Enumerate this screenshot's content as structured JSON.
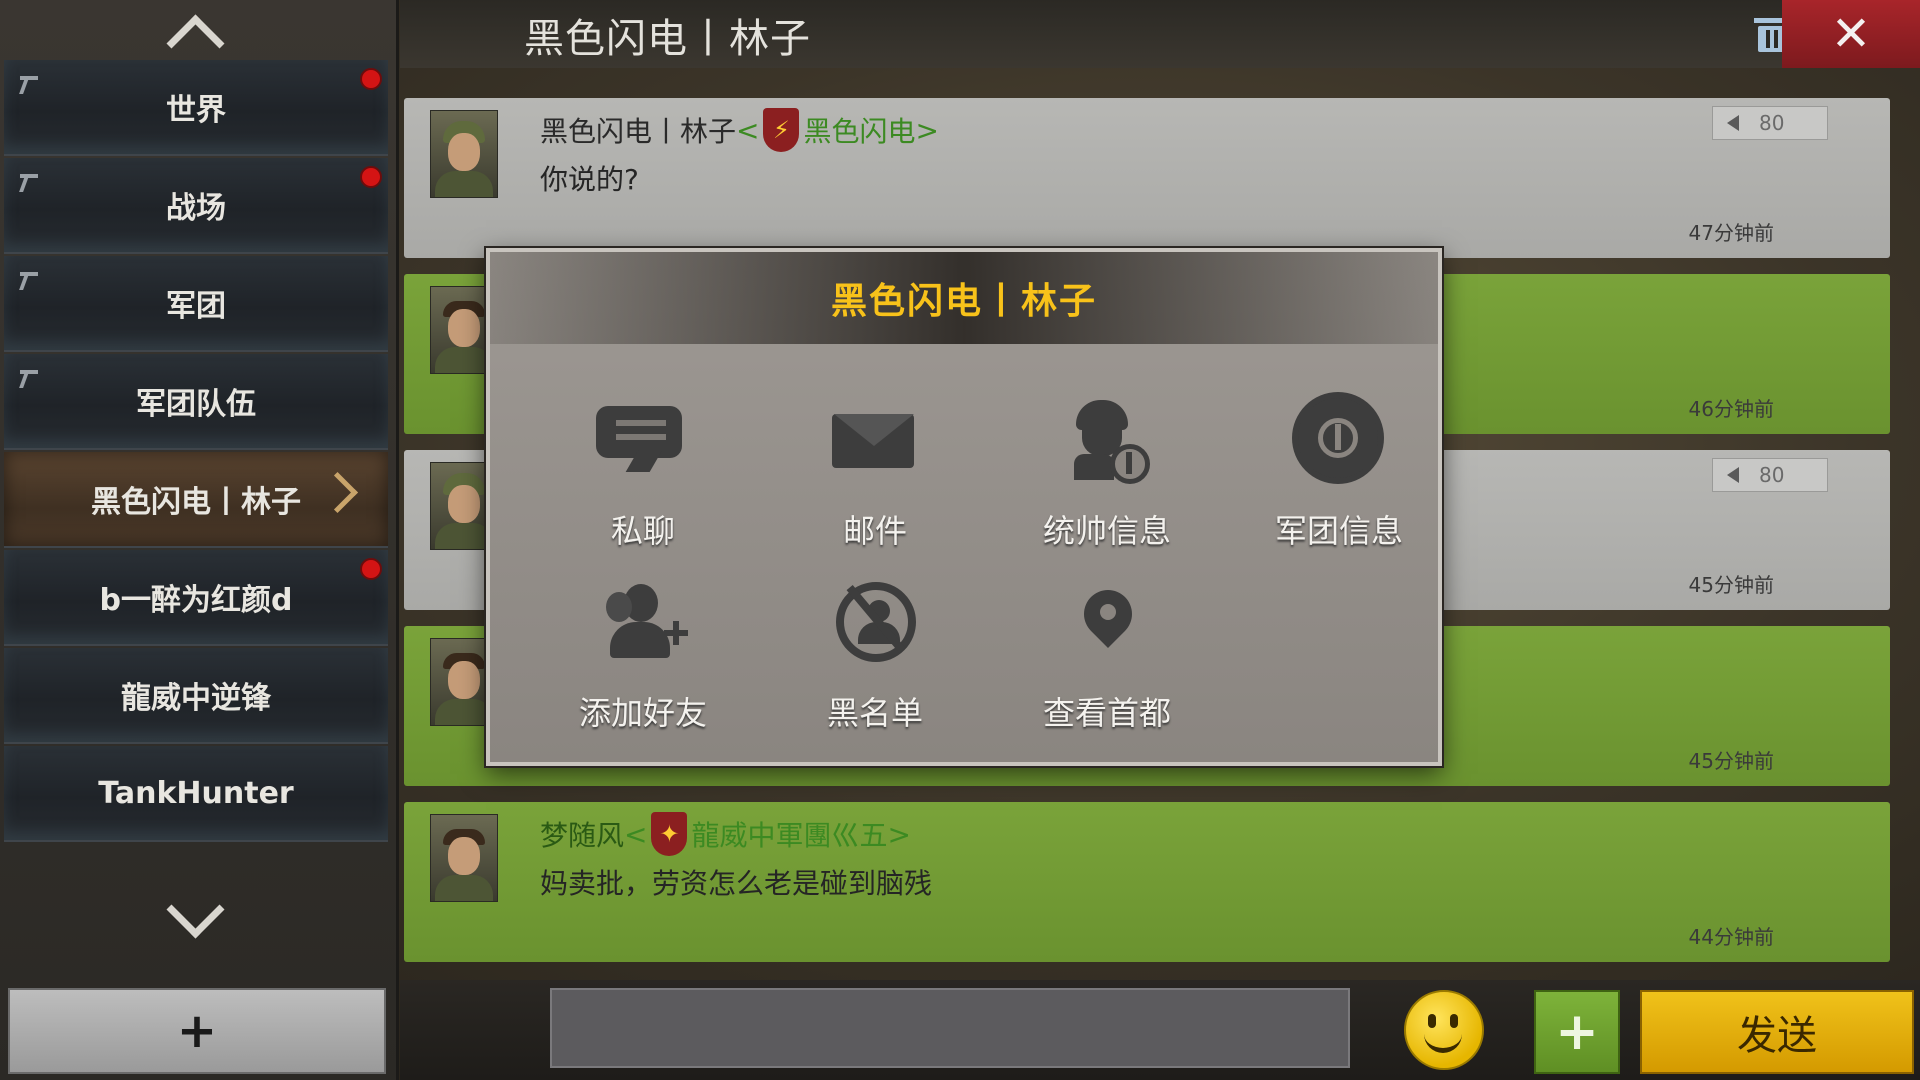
{
  "sidebar": {
    "channels": [
      {
        "label": "世界",
        "pinned": true,
        "unread": true
      },
      {
        "label": "战场",
        "pinned": true,
        "unread": true
      },
      {
        "label": "军团",
        "pinned": true,
        "unread": false
      },
      {
        "label": "军团队伍",
        "pinned": true,
        "unread": false
      },
      {
        "label": "黑色闪电丨林子",
        "pinned": false,
        "unread": false,
        "active": true
      },
      {
        "label": "b一醉为红颜d",
        "pinned": false,
        "unread": true
      },
      {
        "label": "龍威中逆锋",
        "pinned": false,
        "unread": false
      },
      {
        "label": "TankHunter",
        "pinned": false,
        "unread": false
      }
    ],
    "add_label": "+"
  },
  "header": {
    "title": "黑色闪电丨林子",
    "close_label": "✕"
  },
  "messages": [
    {
      "sender": "黑色闪电丨林子",
      "guild": "黑色闪电",
      "text": "你说的?",
      "time": "47分钟前",
      "style": "gray",
      "speaker": "80"
    },
    {
      "time": "46分钟前",
      "style": "green"
    },
    {
      "time": "45分钟前",
      "style": "gray",
      "speaker": "80"
    },
    {
      "time": "45分钟前",
      "style": "green"
    },
    {
      "sender": "梦随风",
      "guild": "龍威中軍團巛五",
      "text": "妈卖批，劳资怎么老是碰到脑残",
      "time": "44分钟前",
      "style": "green"
    }
  ],
  "popup": {
    "title": "黑色闪电丨林子",
    "actions": [
      {
        "label": "私聊",
        "icon": "chat-bubbles-icon"
      },
      {
        "label": "邮件",
        "icon": "envelope-icon"
      },
      {
        "label": "统帅信息",
        "icon": "commander-info-icon"
      },
      {
        "label": "军团信息",
        "icon": "legion-gear-icon"
      },
      {
        "label": "添加好友",
        "icon": "add-friend-icon"
      },
      {
        "label": "黑名单",
        "icon": "blacklist-icon"
      },
      {
        "label": "查看首都",
        "icon": "map-pin-icon"
      }
    ]
  },
  "composer": {
    "input_value": "",
    "send_label": "发送",
    "add_label": "+"
  },
  "colors": {
    "send_button": "#e0a800",
    "close_button": "#a8252a",
    "popup_title": "#f8c21a",
    "green_message": "#7aa33a",
    "gray_message": "#b7b7b4",
    "guild_name": "#3c8a22"
  }
}
